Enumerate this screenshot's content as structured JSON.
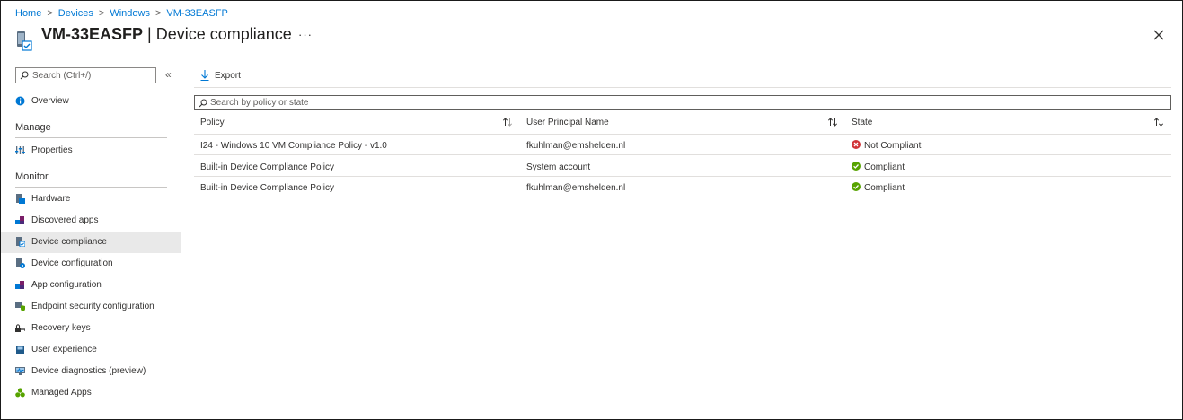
{
  "breadcrumb": [
    "Home",
    "Devices",
    "Windows",
    "VM-33EASFP"
  ],
  "breadcrumb_separator": ">",
  "header": {
    "resource_name": "VM-33EASFP",
    "separator": " | ",
    "page_name": "Device compliance",
    "more_label": "···",
    "close_icon": "close-icon"
  },
  "sidebar": {
    "search_placeholder": "Search (Ctrl+/)",
    "collapse_label": "«",
    "overview": "Overview",
    "sections": {
      "manage": "Manage",
      "monitor": "Monitor"
    },
    "manage_items": [
      "Properties"
    ],
    "monitor_items": [
      "Hardware",
      "Discovered apps",
      "Device compliance",
      "Device configuration",
      "App configuration",
      "Endpoint security configuration",
      "Recovery keys",
      "User experience",
      "Device diagnostics (preview)",
      "Managed Apps"
    ],
    "active_item": "Device compliance"
  },
  "toolbar": {
    "export_label": "Export"
  },
  "table": {
    "search_placeholder": "Search by policy or state",
    "columns": [
      "Policy",
      "User Principal Name",
      "State"
    ],
    "rows": [
      {
        "policy": "I24 - Windows 10 VM Compliance Policy - v1.0",
        "upn": "fkuhlman@emshelden.nl",
        "state": "Not Compliant",
        "status": "error"
      },
      {
        "policy": "Built-in Device Compliance Policy",
        "upn": "System account",
        "state": "Compliant",
        "status": "success"
      },
      {
        "policy": "Built-in Device Compliance Policy",
        "upn": "fkuhlman@emshelden.nl",
        "state": "Compliant",
        "status": "success"
      }
    ]
  },
  "colors": {
    "accent": "#0078d4",
    "error": "#d13438",
    "success": "#57a300",
    "active_nav_bg": "#e9e9e9"
  }
}
